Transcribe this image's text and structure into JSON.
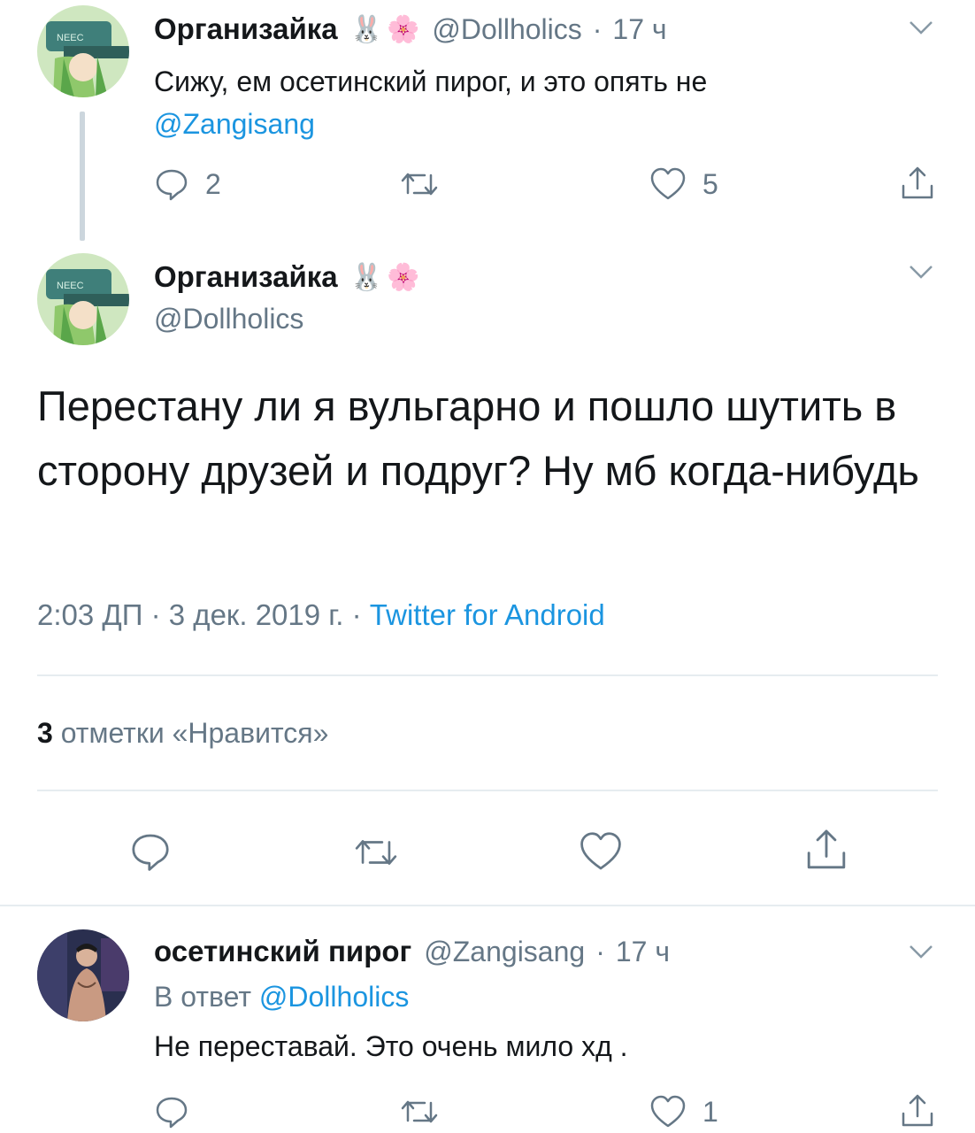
{
  "thread_tweet": {
    "display_name": "Организайка",
    "emoji_1": "🐰",
    "emoji_2": "🌸",
    "handle": "@Dollholics",
    "time": "17 ч",
    "text": "Сижу, ем осетинский пирог, и это опять не",
    "mention": "@Zangisang",
    "reply_count": "2",
    "retweet_count": "",
    "like_count": "5"
  },
  "main_tweet": {
    "display_name": "Организайка",
    "emoji_1": "🐰",
    "emoji_2": "🌸",
    "handle": "@Dollholics",
    "text": "Перестану ли я вульгарно и пошло шутить в сторону друзей и подруг?  Ну мб когда-нибудь",
    "timestamp": "2:03 ДП · 3 дек. 2019 г. · ",
    "source": "Twitter for Android",
    "likes_count": "3",
    "likes_label": "отметки «Нравится»"
  },
  "reply_tweet": {
    "display_name": "осетинский пирог",
    "handle": "@Zangisang",
    "time": "17 ч",
    "reply_to_label": "В ответ",
    "reply_to_handle": "@Dollholics",
    "text": "Не переставай. Это очень мило хд .",
    "reply_count": "",
    "retweet_count": "",
    "like_count": "1"
  },
  "colors": {
    "link": "#1b95e0",
    "muted": "#657786",
    "text": "#14171a",
    "divider": "#e6ecf0",
    "thread_line": "#ccd6dd"
  }
}
